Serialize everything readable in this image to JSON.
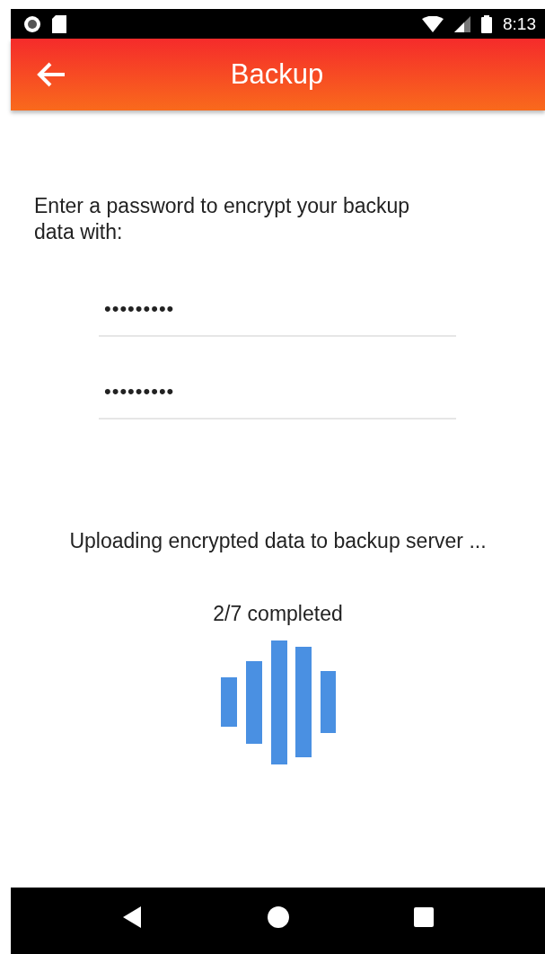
{
  "status_bar": {
    "time": "8:13"
  },
  "app_bar": {
    "title": "Backup"
  },
  "prompt": "Enter a password to encrypt your backup data with:",
  "password_fields": [
    {
      "value": "•••••••••"
    },
    {
      "value": "•••••••••"
    }
  ],
  "status_message": "Uploading encrypted data to backup server ...",
  "progress_text": "2/7 completed"
}
